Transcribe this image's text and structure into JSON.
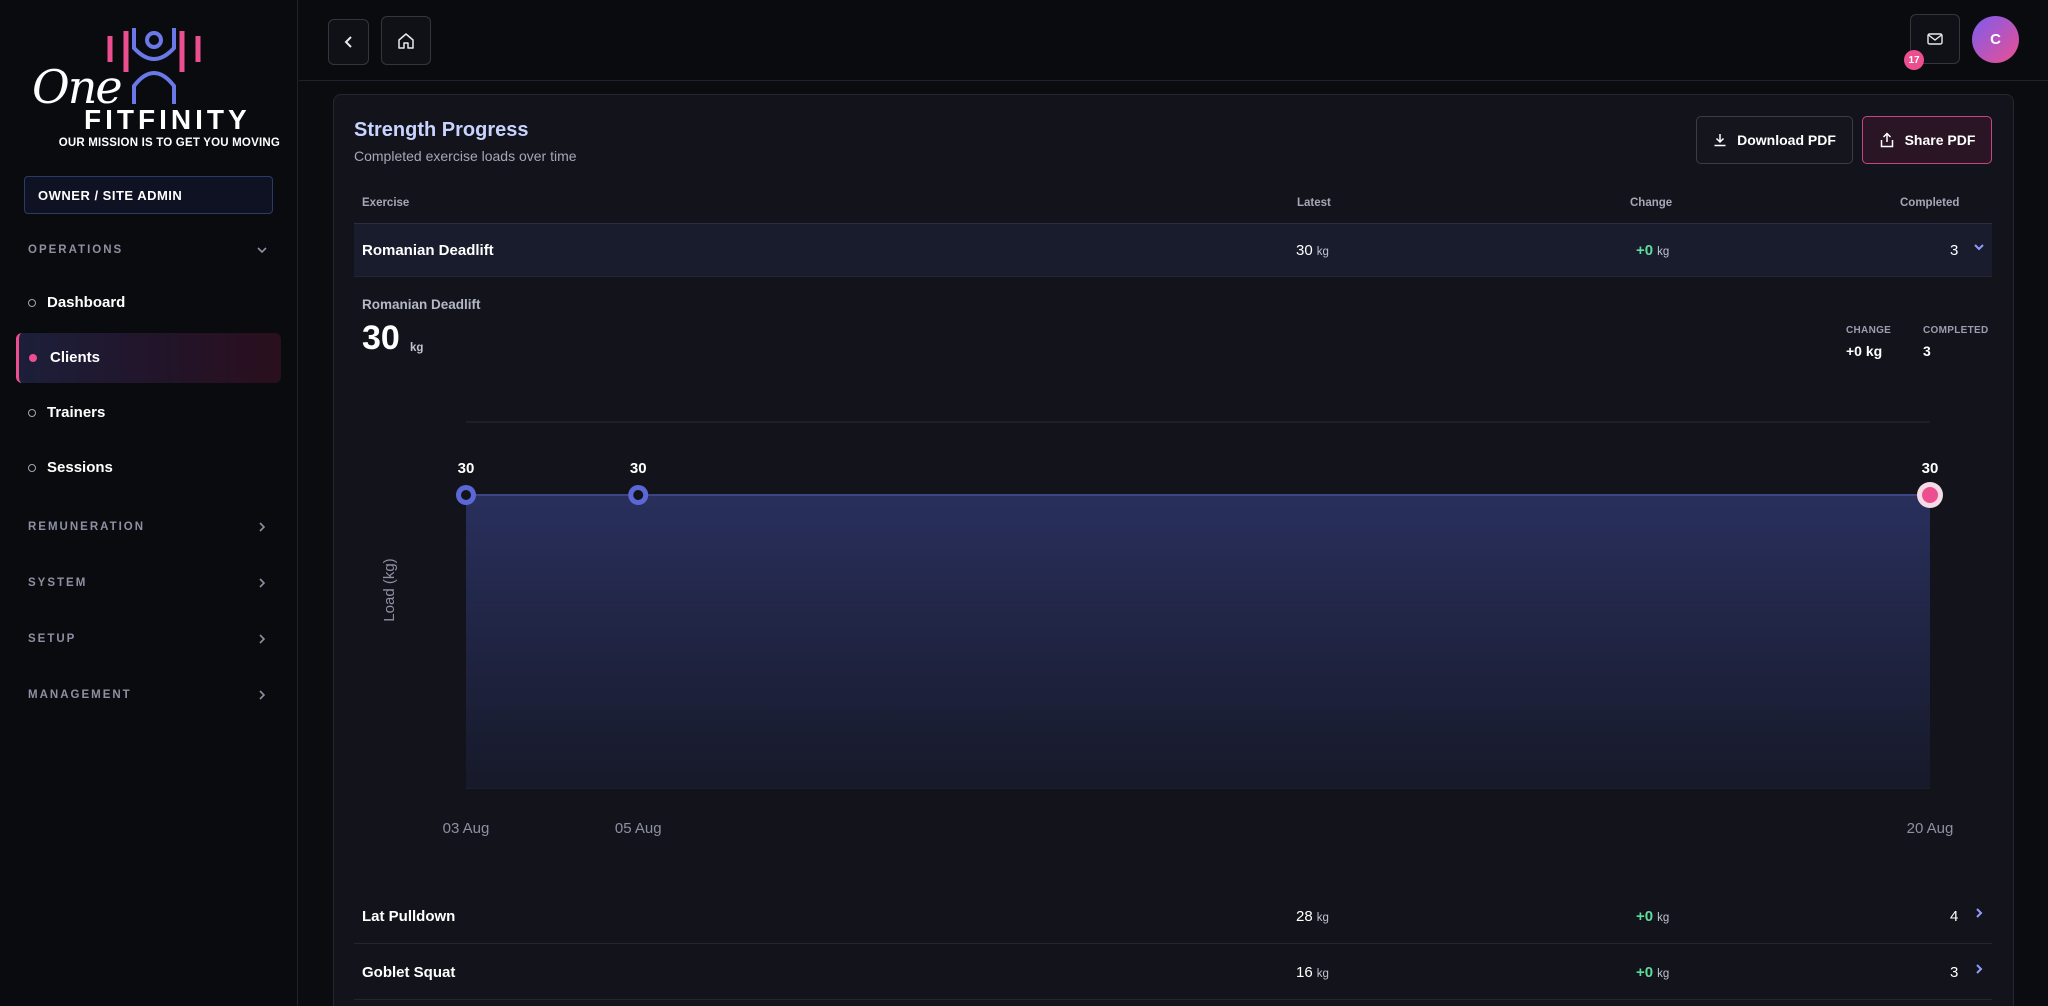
{
  "brand": {
    "logo_script": "One",
    "logo_word": "FITFINITY",
    "tagline": "OUR MISSION IS TO GET YOU MOVING",
    "accent_pink": "#ec4f8f",
    "accent_blue": "#5b67d6"
  },
  "sidebar": {
    "role": "OWNER / SITE ADMIN",
    "sections": [
      {
        "label": "OPERATIONS",
        "expanded": true,
        "icon": "chevron-down-icon"
      },
      {
        "label": "REMUNERATION",
        "expanded": false,
        "icon": "chevron-right-icon"
      },
      {
        "label": "SYSTEM",
        "expanded": false,
        "icon": "chevron-right-icon"
      },
      {
        "label": "SETUP",
        "expanded": false,
        "icon": "chevron-right-icon"
      },
      {
        "label": "MANAGEMENT",
        "expanded": false,
        "icon": "chevron-right-icon"
      }
    ],
    "items": [
      {
        "label": "Dashboard",
        "active": false
      },
      {
        "label": "Clients",
        "active": true
      },
      {
        "label": "Trainers",
        "active": false
      },
      {
        "label": "Sessions",
        "active": false
      }
    ]
  },
  "topbar": {
    "back_icon": "chevron-left-icon",
    "home_icon": "home-icon",
    "mail_icon": "mail-icon",
    "mail_count": "17",
    "avatar_initial": "C"
  },
  "panel": {
    "title": "Strength Progress",
    "subtitle": "Completed exercise loads over time",
    "download_label": "Download PDF",
    "share_label": "Share PDF",
    "columns": [
      "Exercise",
      "Latest",
      "Change",
      "Completed"
    ],
    "rows": [
      {
        "name": "Romanian Deadlift",
        "latest": "30",
        "latest_unit": "kg",
        "change": "+0",
        "change_unit": "kg",
        "completed": "3",
        "expanded": true
      },
      {
        "name": "Lat Pulldown",
        "latest": "28",
        "latest_unit": "kg",
        "change": "+0",
        "change_unit": "kg",
        "completed": "4",
        "expanded": false
      },
      {
        "name": "Goblet Squat",
        "latest": "16",
        "latest_unit": "kg",
        "change": "+0",
        "change_unit": "kg",
        "completed": "3",
        "expanded": false
      }
    ],
    "detail": {
      "name": "Romanian Deadlift",
      "value": "30",
      "unit": "kg",
      "change_label": "CHANGE",
      "change_value": "+0 kg",
      "completed_label": "COMPLETED",
      "completed_value": "3"
    }
  },
  "chart_data": {
    "type": "area",
    "x": [
      "03 Aug",
      "05 Aug",
      "20 Aug"
    ],
    "values": [
      30,
      30,
      30
    ],
    "data_labels": [
      "30",
      "30",
      "30"
    ],
    "ylabel": "Load (kg)",
    "grid": true,
    "colors": {
      "line": "#5b67d6",
      "last_point": "#ec4f8f"
    }
  }
}
